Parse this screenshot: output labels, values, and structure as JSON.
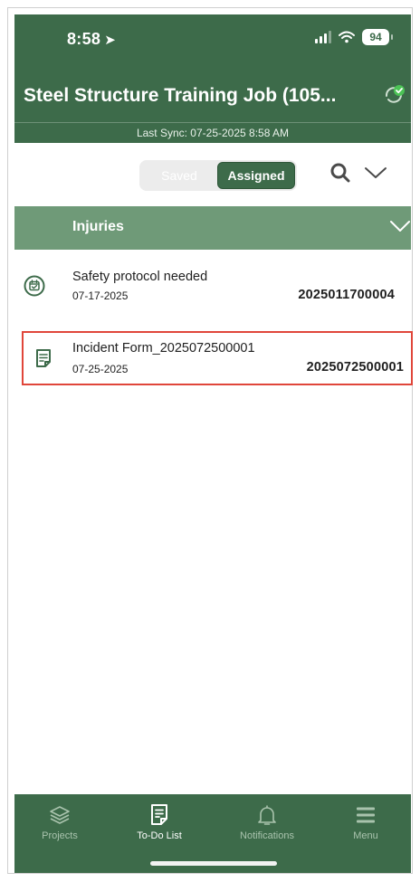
{
  "status_bar": {
    "time": "8:58",
    "battery": "94"
  },
  "header": {
    "job_title": "Steel Structure Training Job (105...",
    "last_sync": "Last Sync: 07-25-2025 8:58 AM"
  },
  "toolbar": {
    "segments": [
      {
        "label": "Saved",
        "active": false
      },
      {
        "label": "Assigned",
        "active": true
      }
    ]
  },
  "section": {
    "label": "Injuries"
  },
  "items": [
    {
      "title": "Safety protocol needed",
      "date": "07-17-2025",
      "number": "2025011700004",
      "icon": "calendar-check-icon"
    },
    {
      "title": "Incident Form_2025072500001",
      "date": "07-25-2025",
      "number": "2025072500001",
      "icon": "form-document-icon"
    }
  ],
  "bottom_nav": [
    {
      "label": "Projects",
      "icon": "layers-icon",
      "active": false
    },
    {
      "label": "To-Do List",
      "icon": "todo-document-icon",
      "active": true
    },
    {
      "label": "Notifications",
      "icon": "bell-icon",
      "active": false
    },
    {
      "label": "Menu",
      "icon": "hamburger-menu-icon",
      "active": false
    }
  ],
  "colors": {
    "header_green": "#3d6b4a",
    "section_green": "#6f9a78",
    "selection_outline": "#e0463a",
    "sync_badge": "#4cc456"
  }
}
